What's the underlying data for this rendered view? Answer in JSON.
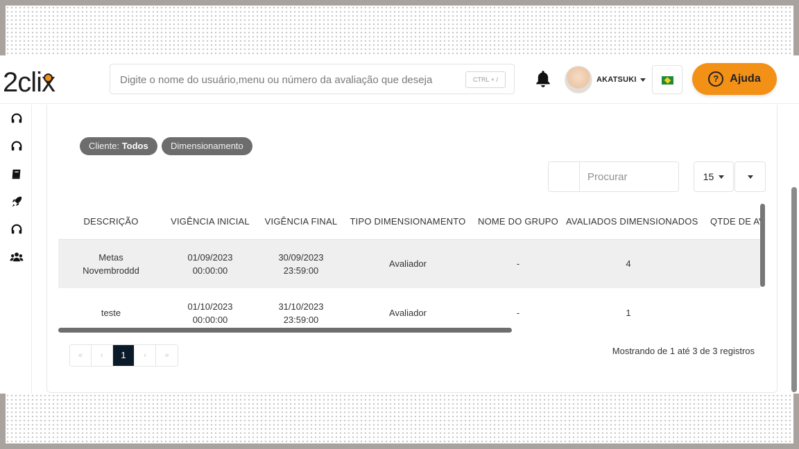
{
  "header": {
    "logo_text": "2clix",
    "search_placeholder": "Digite o nome do usuário,menu ou número da avaliação que deseja",
    "search_shortcut": "CTRL + /",
    "user_name": "AKATSUKI",
    "help_label": "Ajuda",
    "help_icon": "?",
    "brand_color": "#f39016"
  },
  "sidebar": {
    "icons": [
      "headset-icon",
      "headset-icon",
      "book-icon",
      "rocket-icon",
      "headset-icon",
      "users-icon"
    ]
  },
  "filters": {
    "client_label": "Cliente:",
    "client_value": "Todos",
    "type_label": "Dimensionamento"
  },
  "table_controls": {
    "search_placeholder": "Procurar",
    "page_size": "15"
  },
  "table": {
    "columns": [
      "DESCRIÇÃO",
      "VIGÊNCIA INICIAL",
      "VIGÊNCIA FINAL",
      "TIPO DIMENSIONAMENTO",
      "NOME DO GRUPO",
      "AVALIADOS DIMENSIONADOS",
      "QTDE DE AVALIADOS"
    ],
    "rows": [
      {
        "descricao_1": "Metas",
        "descricao_2": "Novembroddd",
        "inicio_data": "01/09/2023",
        "inicio_hora": "00:00:00",
        "fim_data": "30/09/2023",
        "fim_hora": "23:59:00",
        "tipo": "Avaliador",
        "grupo": "-",
        "avaliados": "4"
      },
      {
        "descricao_1": "teste",
        "descricao_2": "",
        "inicio_data": "01/10/2023",
        "inicio_hora": "00:00:00",
        "fim_data": "31/10/2023",
        "fim_hora": "23:59:00",
        "tipo": "Avaliador",
        "grupo": "-",
        "avaliados": "1"
      }
    ]
  },
  "pagination": {
    "first": "«",
    "prev": "‹",
    "current": "1",
    "next": "›",
    "last": "»",
    "info": "Mostrando de 1 até 3 de 3 registros"
  }
}
